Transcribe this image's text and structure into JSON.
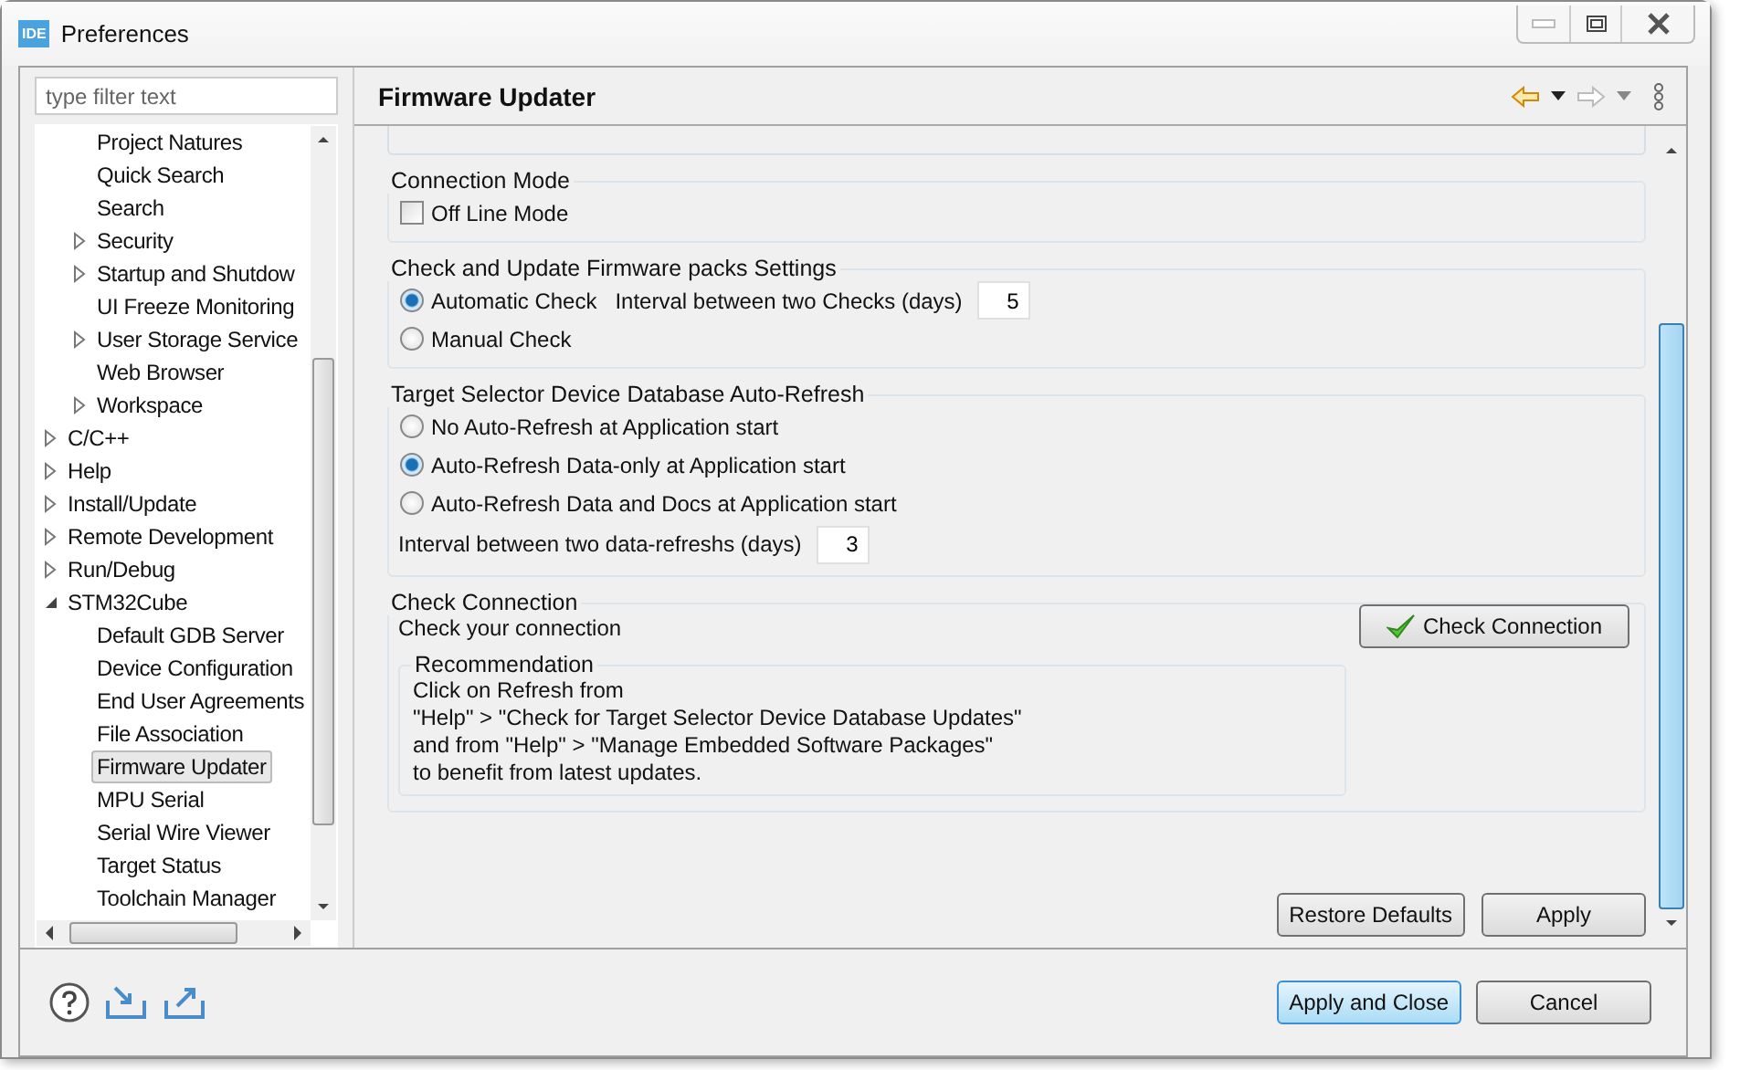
{
  "window": {
    "title": "Preferences",
    "app_badge": "IDE"
  },
  "filter": {
    "placeholder": "type filter text"
  },
  "tree": {
    "continued_children": [
      {
        "label": "Project Natures",
        "expandable": false,
        "expanded": false,
        "selected": false
      },
      {
        "label": "Quick Search",
        "expandable": false,
        "expanded": false,
        "selected": false
      },
      {
        "label": "Search",
        "expandable": false,
        "expanded": false,
        "selected": false
      },
      {
        "label": "Security",
        "expandable": true,
        "expanded": false,
        "selected": false
      },
      {
        "label": "Startup and Shutdow",
        "expandable": true,
        "expanded": false,
        "selected": false
      },
      {
        "label": "UI Freeze Monitoring",
        "expandable": false,
        "expanded": false,
        "selected": false
      },
      {
        "label": "User Storage Service",
        "expandable": true,
        "expanded": false,
        "selected": false
      },
      {
        "label": "Web Browser",
        "expandable": false,
        "expanded": false,
        "selected": false
      },
      {
        "label": "Workspace",
        "expandable": true,
        "expanded": false,
        "selected": false
      }
    ],
    "items": [
      {
        "label": "C/C++",
        "expandable": true,
        "expanded": false,
        "selected": false
      },
      {
        "label": "Help",
        "expandable": true,
        "expanded": false,
        "selected": false
      },
      {
        "label": "Install/Update",
        "expandable": true,
        "expanded": false,
        "selected": false
      },
      {
        "label": "Remote Development",
        "expandable": true,
        "expanded": false,
        "selected": false
      },
      {
        "label": "Run/Debug",
        "expandable": true,
        "expanded": false,
        "selected": false
      },
      {
        "label": "STM32Cube",
        "expandable": true,
        "expanded": true,
        "selected": false,
        "children": [
          {
            "label": "Default GDB Server",
            "expandable": false,
            "expanded": false,
            "selected": false
          },
          {
            "label": "Device Configuration",
            "expandable": false,
            "expanded": false,
            "selected": false
          },
          {
            "label": "End User Agreements",
            "expandable": false,
            "expanded": false,
            "selected": false
          },
          {
            "label": "File Association",
            "expandable": false,
            "expanded": false,
            "selected": false
          },
          {
            "label": "Firmware Updater",
            "expandable": false,
            "expanded": false,
            "selected": true
          },
          {
            "label": "MPU Serial",
            "expandable": false,
            "expanded": false,
            "selected": false
          },
          {
            "label": "Serial Wire Viewer",
            "expandable": false,
            "expanded": false,
            "selected": false
          },
          {
            "label": "Target Status",
            "expandable": false,
            "expanded": false,
            "selected": false
          },
          {
            "label": "Toolchain Manager",
            "expandable": false,
            "expanded": false,
            "selected": false
          }
        ]
      }
    ]
  },
  "page": {
    "title": "Firmware Updater",
    "connection_mode": {
      "title": "Connection Mode",
      "checkbox": {
        "label": "Off Line Mode",
        "checked": false
      }
    },
    "check_update": {
      "title": "Check and Update Firmware packs Settings",
      "options": [
        {
          "label": "Automatic Check",
          "selected": true
        },
        {
          "label": "Manual Check",
          "selected": false
        }
      ],
      "interval_label": "Interval between two Checks (days)",
      "interval_value": "5"
    },
    "auto_refresh": {
      "title": "Target Selector Device Database Auto-Refresh",
      "options": [
        {
          "label": "No Auto-Refresh at Application start",
          "selected": false
        },
        {
          "label": "Auto-Refresh Data-only at Application start",
          "selected": true
        },
        {
          "label": "Auto-Refresh Data and Docs at Application start",
          "selected": false
        }
      ],
      "interval_label": "Interval between two data-refreshs (days)",
      "interval_value": "3"
    },
    "check_connection": {
      "title": "Check Connection",
      "text": "Check your connection",
      "button": "Check Connection",
      "recommendation": {
        "title": "Recommendation",
        "lines": [
          "Click on Refresh from",
          "\"Help\" > \"Check for Target Selector Device Database Updates\"",
          "and from \"Help\" > \"Manage Embedded Software Packages\"",
          "to benefit from latest updates."
        ]
      }
    },
    "buttons": [
      "Restore Defaults",
      "Apply"
    ]
  },
  "dialog_buttons": [
    {
      "label": "Apply and Close",
      "default": true
    },
    {
      "label": "Cancel",
      "default": false
    }
  ]
}
